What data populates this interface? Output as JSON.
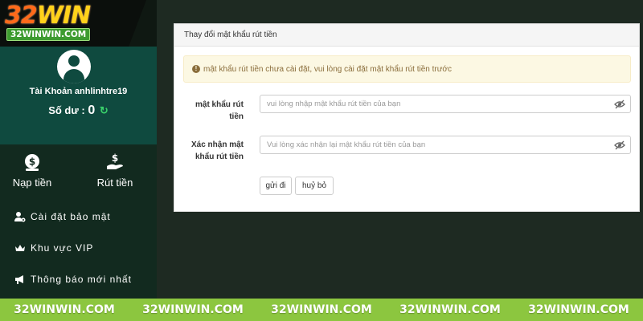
{
  "logo": {
    "main_prefix": "32",
    "main_suffix": "WIN",
    "sub": "32WINWIN.COM"
  },
  "profile": {
    "account_text": "Tài Khoản anhlinhtre19",
    "balance_label": "Số dư :",
    "balance_value": "0"
  },
  "actions": {
    "deposit_label": "Nạp tiền",
    "withdraw_label": "Rút tiền"
  },
  "nav": [
    {
      "label": "Cài đặt bảo mật",
      "icon": "user-gear-icon"
    },
    {
      "label": "Khu vực VIP",
      "icon": "crown-icon"
    },
    {
      "label": "Thông báo mới nhất",
      "icon": "megaphone-icon"
    }
  ],
  "panel": {
    "title": "Thay đổi mật khẩu rút tiền",
    "alert": "mật khẩu rút tiền chưa cài đặt, vui lòng cài đặt mật khẩu rút tiền trước",
    "password": {
      "label_line1": "mật khẩu rút",
      "label_line2": "tiền",
      "placeholder": "vui lòng nhập mật khẩu rút tiền của bạn",
      "value": ""
    },
    "confirm": {
      "label_line1": "Xác nhận mật",
      "label_line2": "khẩu rút tiền",
      "placeholder": "Vui lòng xác nhận lại mật khẩu rút tiền của bạn",
      "value": ""
    },
    "submit_label": "gửi đi",
    "cancel_label": "huỷ bỏ"
  },
  "watermark": [
    "32WINWIN.COM",
    "32WINWIN.COM",
    "32WINWIN.COM",
    "32WINWIN.COM",
    "32WINWIN.COM"
  ],
  "colors": {
    "sidebar": "#122a1f",
    "profile": "#0f4a3f",
    "banner": "#8cc63f",
    "alert_bg": "#fcf8e3"
  }
}
